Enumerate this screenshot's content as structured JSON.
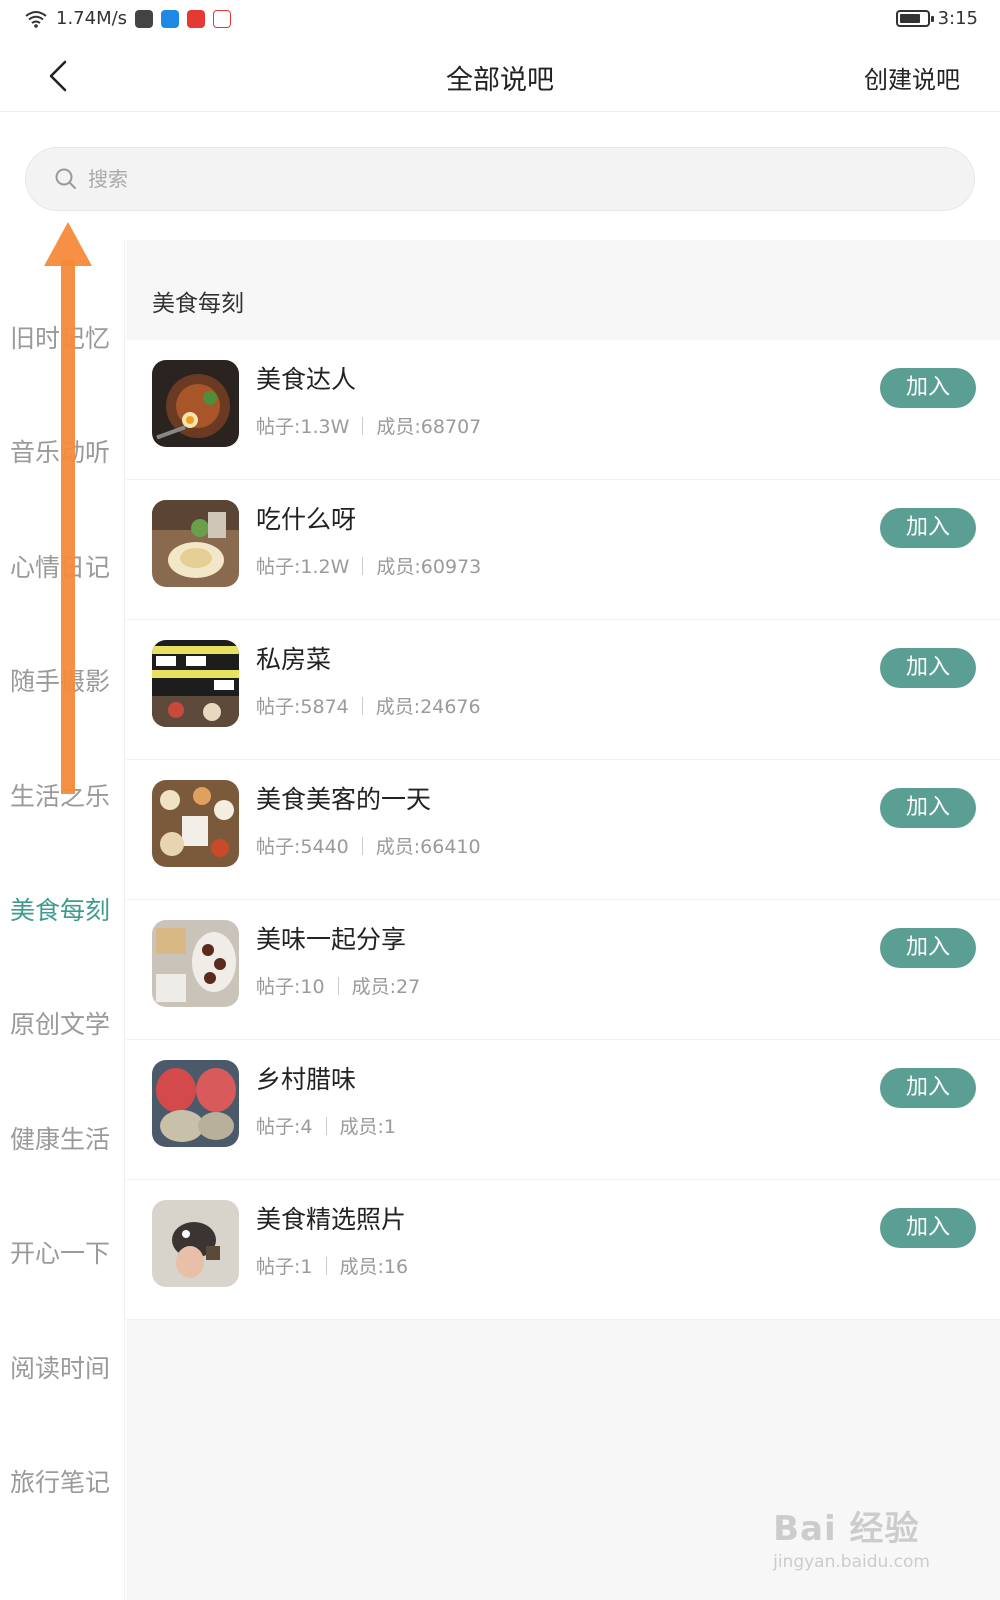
{
  "status_bar": {
    "speed": "1.74M/s",
    "time": "3:15"
  },
  "nav": {
    "title": "全部说吧",
    "create_label": "创建说吧"
  },
  "search": {
    "placeholder": "搜索"
  },
  "sidebar": {
    "active_color": "#3e9c8e",
    "items": [
      {
        "label": "旧时记忆"
      },
      {
        "label": "音乐动听"
      },
      {
        "label": "心情日记"
      },
      {
        "label": "随手摄影"
      },
      {
        "label": "生活之乐"
      },
      {
        "label": "美食每刻",
        "active": true
      },
      {
        "label": "原创文学"
      },
      {
        "label": "健康生活"
      },
      {
        "label": "开心一下"
      },
      {
        "label": "阅读时间"
      },
      {
        "label": "旅行笔记"
      }
    ]
  },
  "content": {
    "section_title": "美食每刻",
    "join_label": "加入",
    "join_color": "#5b9f94",
    "groups": [
      {
        "name": "美食达人",
        "posts": "帖子:1.3W",
        "members": "成员:68707"
      },
      {
        "name": "吃什么呀",
        "posts": "帖子:1.2W",
        "members": "成员:60973"
      },
      {
        "name": "私房菜",
        "posts": "帖子:5874",
        "members": "成员:24676"
      },
      {
        "name": "美食美客的一天",
        "posts": "帖子:5440",
        "members": "成员:66410"
      },
      {
        "name": "美味一起分享",
        "posts": "帖子:10",
        "members": "成员:27"
      },
      {
        "name": "乡村腊味",
        "posts": "帖子:4",
        "members": "成员:1"
      },
      {
        "name": "美食精选照片",
        "posts": "帖子:1",
        "members": "成员:16"
      }
    ]
  },
  "watermark": {
    "logo": "Bai 经验",
    "url": "jingyan.baidu.com"
  }
}
